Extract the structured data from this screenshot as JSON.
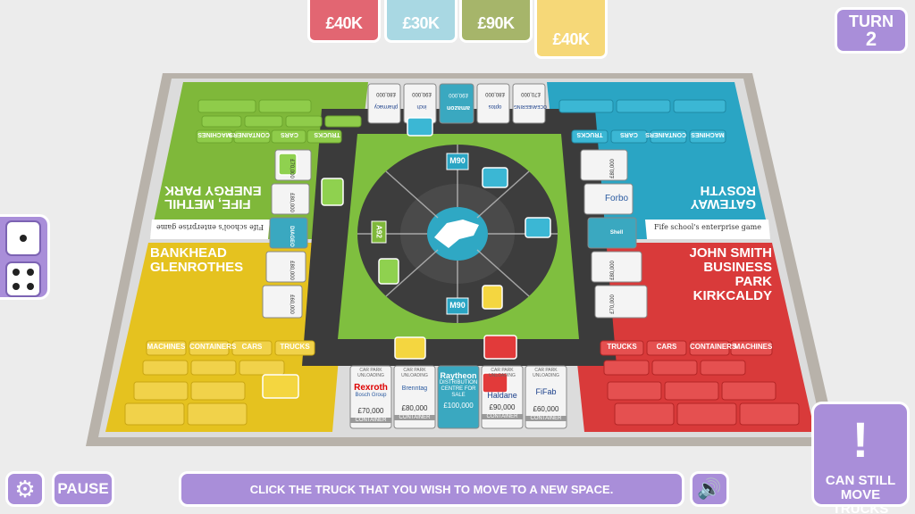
{
  "money": [
    {
      "value": "£40K",
      "color": "#e26672"
    },
    {
      "value": "£30K",
      "color": "#a9d8e3"
    },
    {
      "value": "£90K",
      "color": "#a6b56a"
    },
    {
      "value": "£40K",
      "color": "#f6d878"
    }
  ],
  "turn": {
    "label": "TURN",
    "number": "2"
  },
  "dice": {
    "values": [
      1,
      4
    ]
  },
  "controls": {
    "pause_label": "PAUSE"
  },
  "message": "CLICK THE TRUCK THAT YOU WISH TO MOVE TO A NEW SPACE.",
  "status": {
    "icon": "!",
    "text": "CAN STILL MOVE TRUCKS"
  },
  "board": {
    "regions": {
      "green": {
        "name_line1": "ENERGY PARK",
        "name_line2": "FIFE, METHIL",
        "color": "#7fb83a"
      },
      "blue": {
        "name_line1": "ROSYTH",
        "name_line2": "GATEWAY",
        "color": "#2aa5c4"
      },
      "yellow": {
        "name_line1": "BANKHEAD",
        "name_line2": "GLENROTHES",
        "color": "#e5c21f"
      },
      "red": {
        "name_line1": "JOHN SMITH",
        "name_line2": "BUSINESS PARK",
        "name_line3": "KIRKCALDY",
        "color": "#d93a3a"
      }
    },
    "cargo_labels": [
      "MACHINES",
      "CONTAINERS",
      "CARS",
      "TRUCKS"
    ],
    "banner_text": "Fife school's enterprise game",
    "road_signs": {
      "m90_top": "M90",
      "m90_bottom": "M90",
      "a92": "A92"
    },
    "bottom_cards": [
      {
        "top": "CAR PARK UNLOADING",
        "company": "Rexroth",
        "sub": "Bosch Group",
        "price": "£70,000",
        "type": "CONTAINER"
      },
      {
        "top": "CAR PARK UNLOADING",
        "company": "Brenntag",
        "sub": "",
        "price": "£80,000",
        "type": "CONTAINER"
      },
      {
        "top": "",
        "company": "Raytheon",
        "sub": "DISTRIBUTION CENTRE FOR SALE",
        "price": "£100,000",
        "type": ""
      },
      {
        "top": "CAR PARK UNLOADING",
        "company": "Haldane",
        "sub": "",
        "price": "£90,000",
        "type": "CONTAINER"
      },
      {
        "top": "CAR PARK UNLOADING",
        "company": "FiFab",
        "sub": "",
        "price": "£60,000",
        "type": "CONTAINER"
      }
    ],
    "top_cards": [
      {
        "price": "£80,000",
        "company": "pharmacy"
      },
      {
        "price": "£90,000",
        "company": "inch"
      },
      {
        "price": "£90,000",
        "company": "amazon"
      },
      {
        "price": "£80,000",
        "company": "optos"
      },
      {
        "price": "£70,000",
        "company": "OCEANEERING"
      }
    ],
    "left_cards": [
      {
        "price": "£70,000"
      },
      {
        "price": "£80,000"
      },
      {
        "price": "DIAGEO"
      },
      {
        "price": "£80,000"
      },
      {
        "price": "£60,000"
      }
    ],
    "right_cards": [
      {
        "price": "£80,000"
      },
      {
        "price": "Forbo"
      },
      {
        "price": "Shell"
      },
      {
        "price": "£80,000"
      },
      {
        "price": "£70,000"
      }
    ]
  }
}
